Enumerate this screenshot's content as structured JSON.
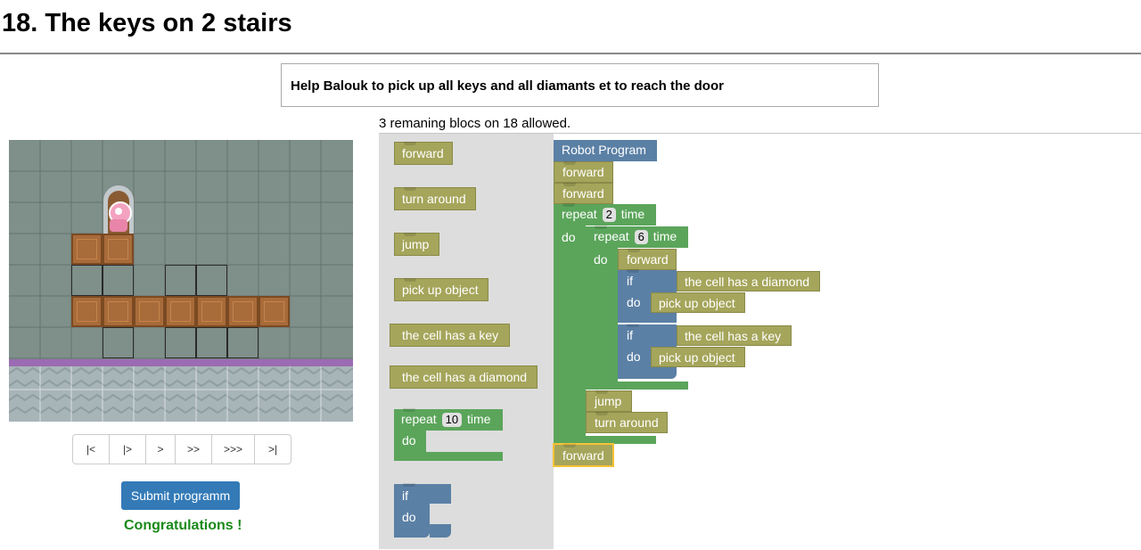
{
  "page": {
    "title": "18. The keys on 2 stairs",
    "goal": "Help Balouk to pick up all keys and all diamants et to reach the door",
    "remaining": "3 remaning blocs on 18 allowed."
  },
  "controls": {
    "nav_buttons": [
      "|<",
      "|>",
      ">",
      ">>",
      ">>>",
      ">|"
    ],
    "submit_label": "Submit programm",
    "status": "Congratulations !"
  },
  "toolbox": {
    "forward": "forward",
    "turn_around": "turn around",
    "jump": "jump",
    "pick_up": "pick up object",
    "cell_key": "the cell has a key",
    "cell_diamond": "the cell has a diamond",
    "repeat_label": "repeat",
    "repeat_count": "10",
    "time_label": "time",
    "do_label": "do",
    "if_label": "if",
    "if_do_label": "do"
  },
  "program": {
    "header": "Robot Program",
    "b1": "forward",
    "b2": "forward",
    "outer_repeat": "repeat",
    "outer_count": "2",
    "outer_time": "time",
    "outer_do": "do",
    "inner_repeat": "repeat",
    "inner_count": "6",
    "inner_time": "time",
    "inner_do": "do",
    "inner_forward": "forward",
    "if1": "if",
    "if1_cond": "the cell has a diamond",
    "if1_do": "do",
    "if1_action": "pick up object",
    "if2": "if",
    "if2_cond": "the cell has a key",
    "if2_do": "do",
    "if2_action": "pick up object",
    "jump": "jump",
    "turn_around": "turn around",
    "last_forward": "forward"
  },
  "colors": {
    "action": "#a5a55b",
    "loop": "#5ba55b",
    "logic": "#5b80a5",
    "header": "#5b80a5",
    "submit": "#337ab7",
    "success": "#1a8a1a"
  }
}
